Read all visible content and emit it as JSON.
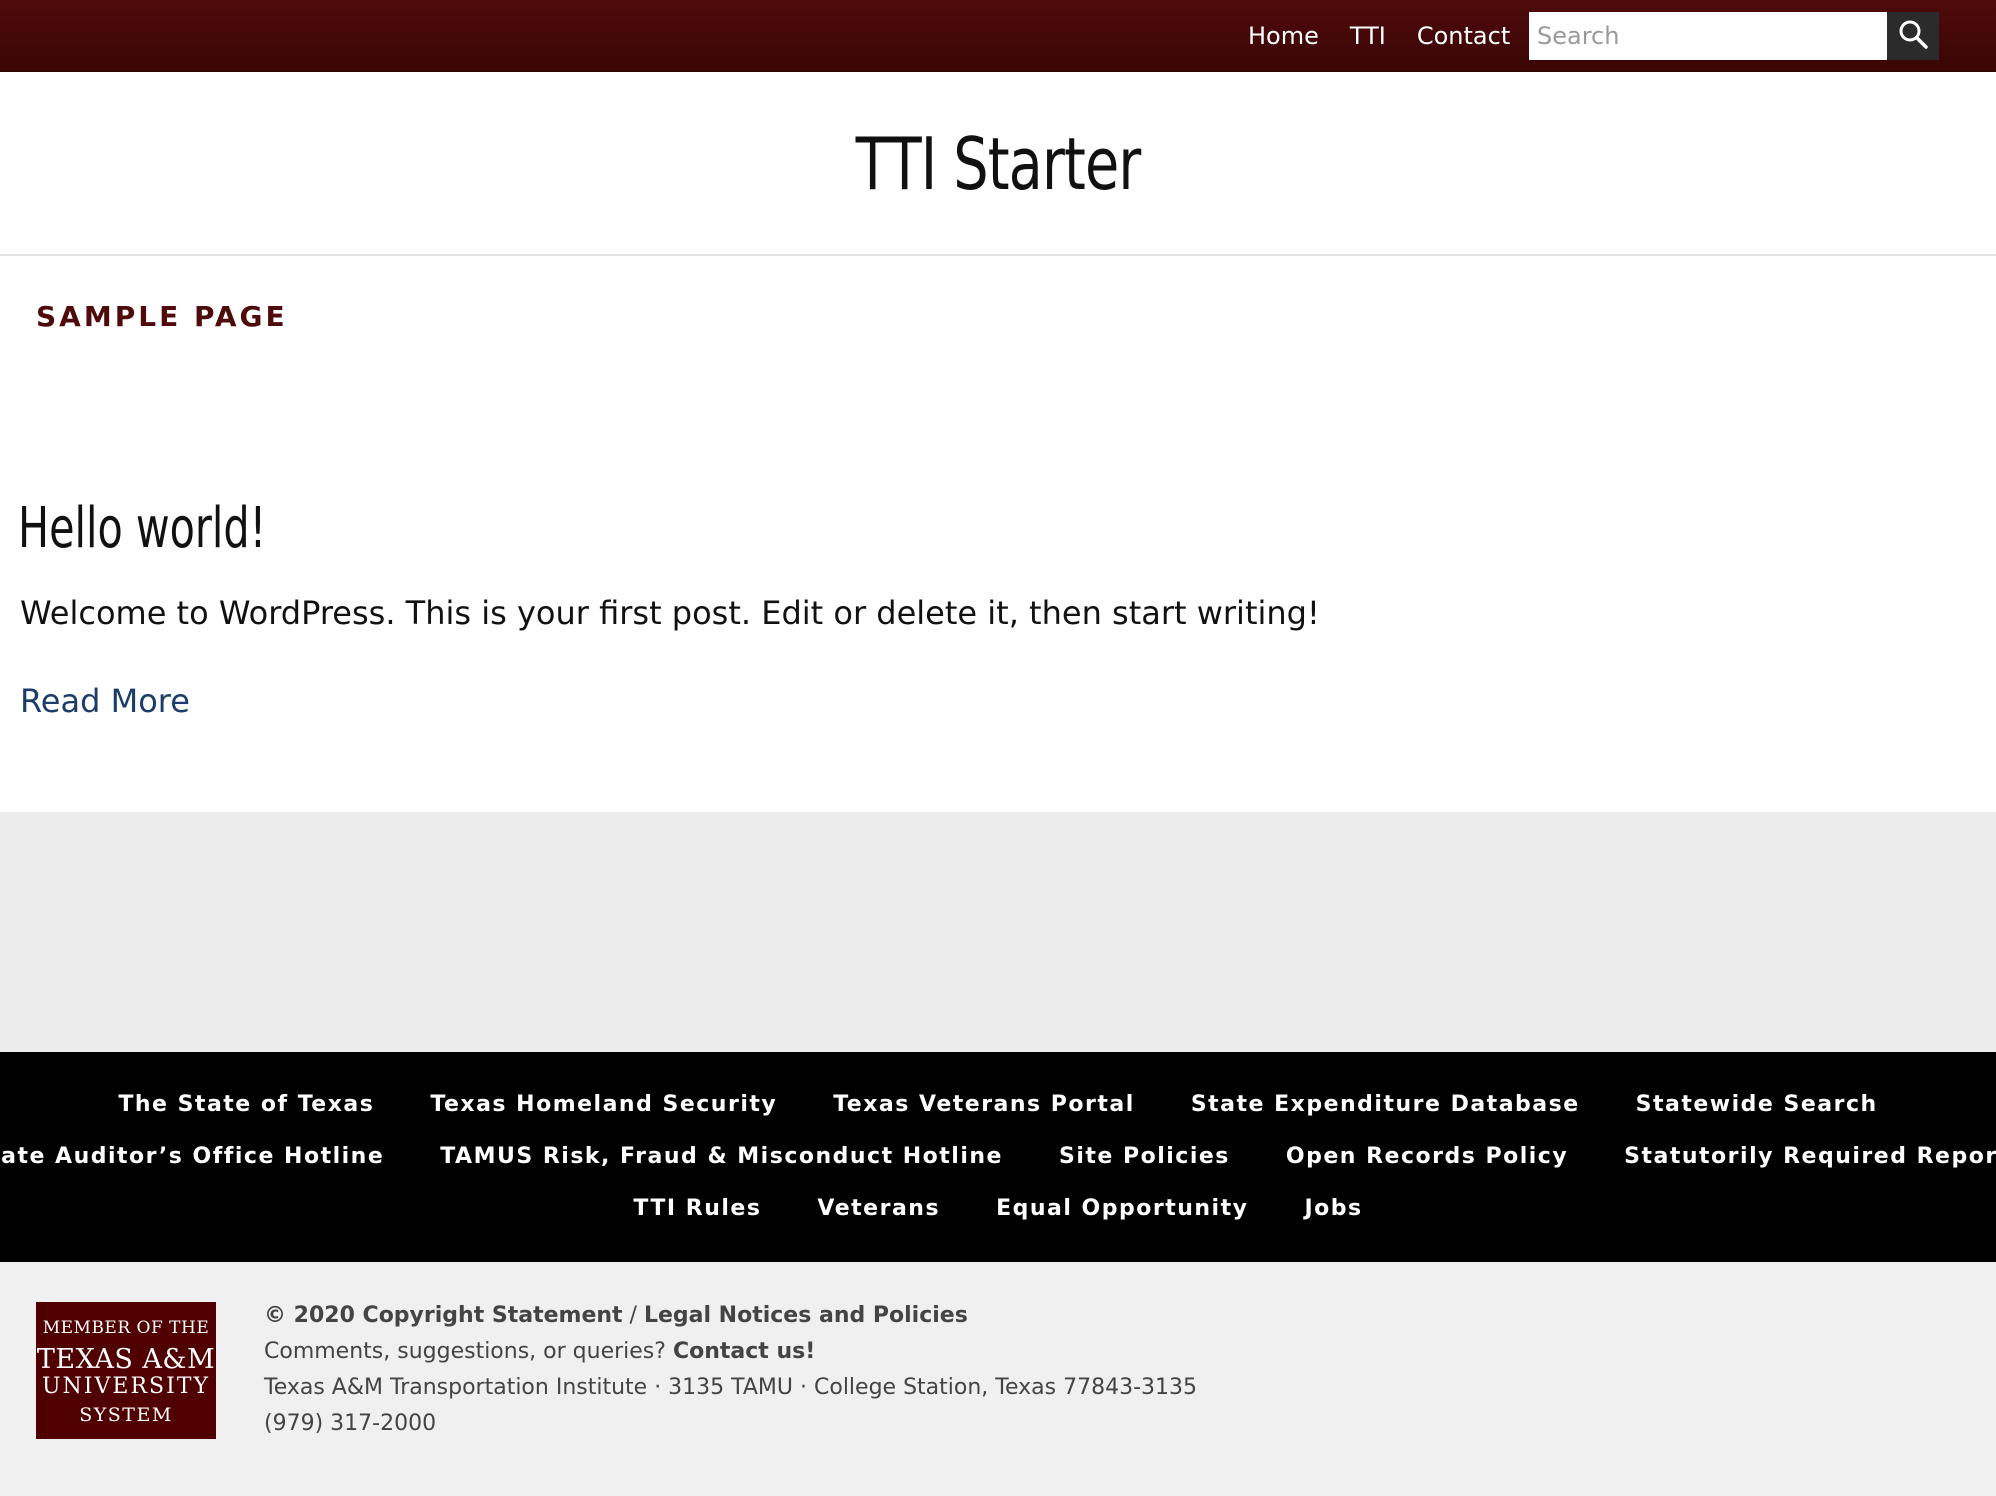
{
  "topnav": {
    "items": [
      "Home",
      "TTI",
      "Contact"
    ],
    "search_placeholder": "Search",
    "search_icon": "search-icon"
  },
  "header": {
    "site_title": "TTI Starter"
  },
  "main": {
    "nav_label": "SAMPLE PAGE",
    "post_title": "Hello world!",
    "post_excerpt": "Welcome to WordPress. This is your first post. Edit or delete it, then start writing!",
    "read_more": "Read More"
  },
  "footer_links": {
    "row1": [
      "The State of Texas",
      "Texas Homeland Security",
      "Texas Veterans Portal",
      "State Expenditure Database",
      "Statewide Search"
    ],
    "row2": [
      "State Auditor’s Office Hotline",
      "TAMUS Risk, Fraud & Misconduct Hotline",
      "Site Policies",
      "Open Records Policy",
      "Statutorily Required Reports"
    ],
    "row3": [
      "TTI Rules",
      "Veterans",
      "Equal Opportunity",
      "Jobs"
    ]
  },
  "bottom": {
    "logo": {
      "line1": "MEMBER OF THE",
      "line2": "TEXAS A&M",
      "line3": "UNIVERSITY",
      "line4": "SYSTEM"
    },
    "copyright": "© 2020 Copyright Statement",
    "separator": " / ",
    "legal_link": "Legal Notices and Policies",
    "comments_text": "Comments, suggestions, or queries? ",
    "contact_link": "Contact us!",
    "address": "Texas A&M Transportation Institute · 3135 TAMU · College Station, Texas 77843-3135",
    "phone": "(979) 317-2000"
  },
  "colors": {
    "maroon": "#500000",
    "topbar": "#4f0a0b",
    "link_blue": "#1c3d6b"
  }
}
